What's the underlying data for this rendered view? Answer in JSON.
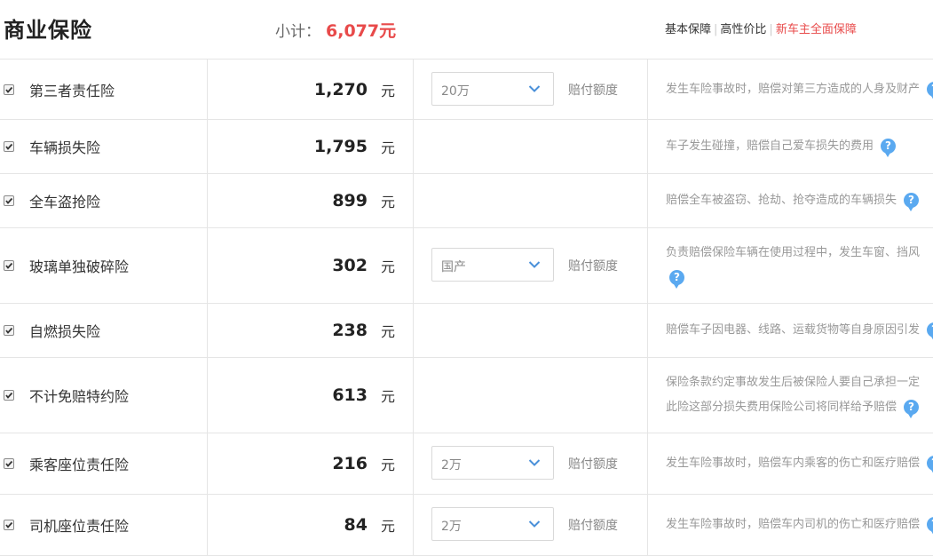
{
  "header": {
    "title": "商业保险",
    "subtotal_label": "小计：",
    "subtotal_value": "6,077元",
    "plans": [
      "基本保障",
      "高性价比",
      "新车主全面保障"
    ]
  },
  "unit": "元",
  "amount_label": "赔付额度",
  "help_glyph": "?",
  "rows": [
    {
      "name": "第三者责任险",
      "price": "1,270",
      "select": "20万",
      "desc": [
        "发生车险事故时，赔偿对第三方造成的人身及财产"
      ],
      "checked": true
    },
    {
      "name": "车辆损失险",
      "price": "1,795",
      "desc": [
        "车子发生碰撞，赔偿自己爱车损失的费用"
      ],
      "checked": true
    },
    {
      "name": "全车盗抢险",
      "price": "899",
      "desc": [
        "赔偿全车被盗窃、抢劫、抢夺造成的车辆损失"
      ],
      "checked": true
    },
    {
      "name": "玻璃单独破碎险",
      "price": "302",
      "select": "国产",
      "desc": [
        "负责赔偿保险车辆在使用过程中，发生车窗、挡风",
        ""
      ],
      "checked": true
    },
    {
      "name": "自燃损失险",
      "price": "238",
      "desc": [
        "赔偿车子因电器、线路、运载货物等自身原因引发"
      ],
      "checked": true
    },
    {
      "name": "不计免赔特约险",
      "price": "613",
      "desc": [
        "保险条款约定事故发生后被保险人要自己承担一定",
        "此险这部分损失费用保险公司将同样给予赔偿"
      ],
      "checked": true
    },
    {
      "name": "乘客座位责任险",
      "price": "216",
      "select": "2万",
      "desc": [
        "发生车险事故时，赔偿车内乘客的伤亡和医疗赔偿"
      ],
      "checked": true
    },
    {
      "name": "司机座位责任险",
      "price": "84",
      "select": "2万",
      "desc": [
        "发生车险事故时，赔偿车内司机的伤亡和医疗赔偿"
      ],
      "checked": true
    }
  ]
}
